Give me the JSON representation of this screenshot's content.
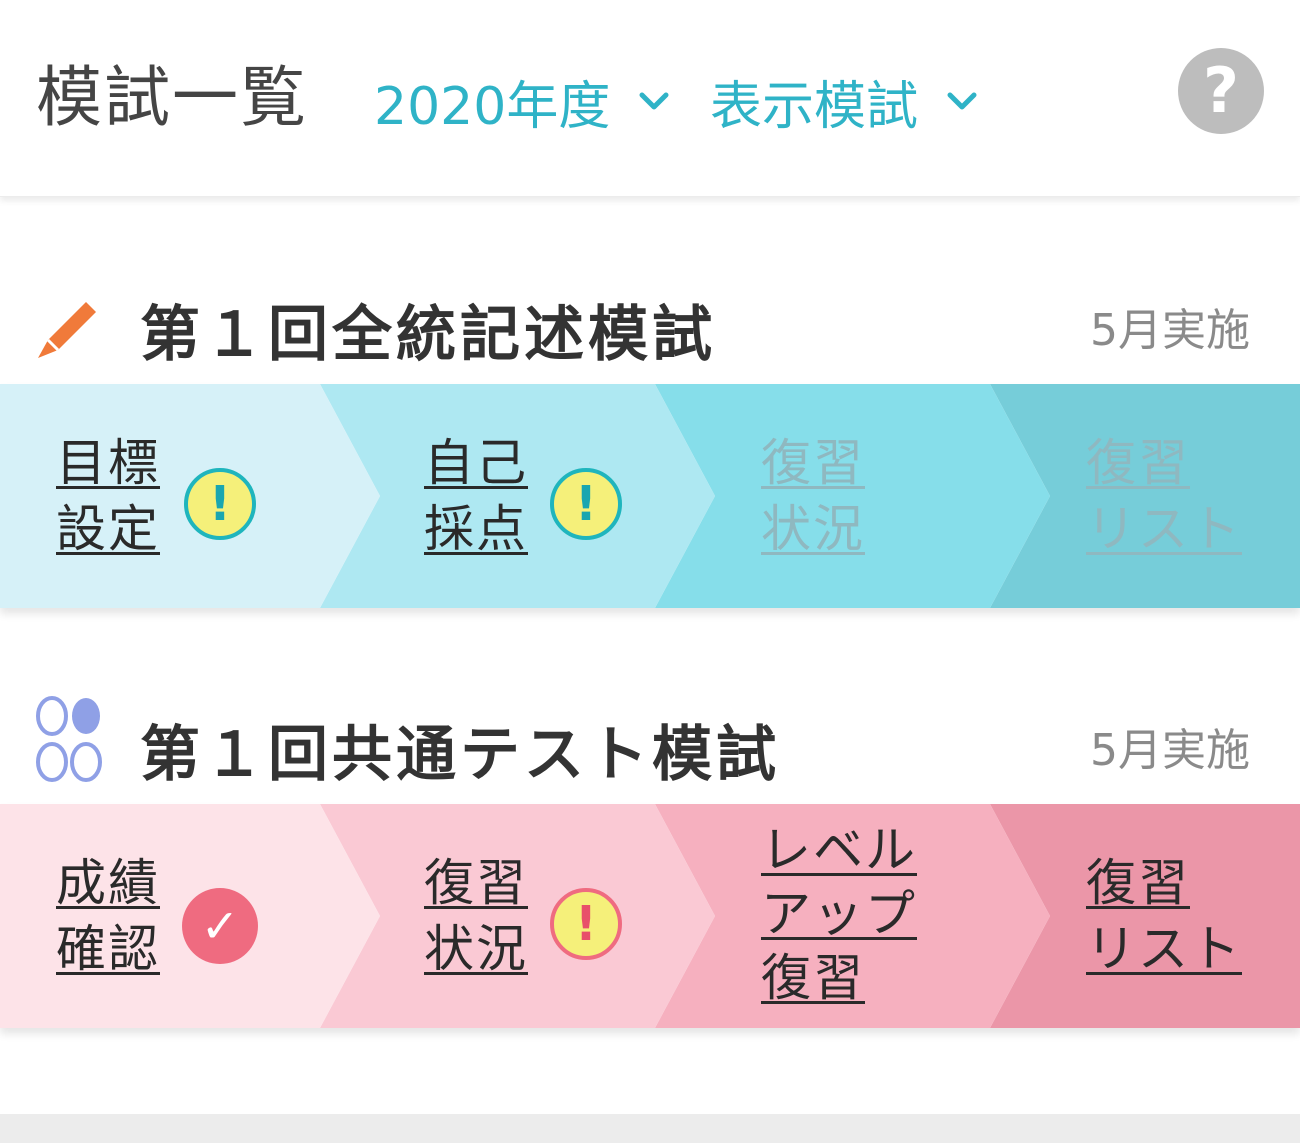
{
  "header": {
    "title": "模試一覧",
    "year_filter": "2020年度",
    "type_filter": "表示模試",
    "help_label": "?"
  },
  "exams": [
    {
      "title": "第１回全統記述模試",
      "date": "5月実施",
      "icon": "pencil-icon",
      "steps": [
        {
          "lines": [
            "目標",
            "設定"
          ],
          "badge": "warning",
          "enabled": true
        },
        {
          "lines": [
            "自己",
            "採点"
          ],
          "badge": "warning",
          "enabled": true
        },
        {
          "lines": [
            "復習",
            "状況"
          ],
          "badge": null,
          "enabled": false
        },
        {
          "lines": [
            "復習",
            "リスト"
          ],
          "badge": null,
          "enabled": false
        }
      ]
    },
    {
      "title": "第１回共通テスト模試",
      "date": "5月実施",
      "icon": "mark-sheet-icon",
      "steps": [
        {
          "lines": [
            "成績",
            "確認"
          ],
          "badge": "check",
          "enabled": true
        },
        {
          "lines": [
            "復習",
            "状況"
          ],
          "badge": "warning",
          "enabled": true
        },
        {
          "lines": [
            "レベル",
            "アップ",
            "復習"
          ],
          "badge": null,
          "enabled": true
        },
        {
          "lines": [
            "復習",
            "リスト"
          ],
          "badge": null,
          "enabled": true
        }
      ]
    }
  ],
  "badge_symbols": {
    "warning": "!",
    "check": "✓"
  },
  "colors": {
    "accent": "#2fb3c7",
    "blue_steps": [
      "#d6f1f8",
      "#aee8f2",
      "#86deea",
      "#76cdd9"
    ],
    "pink_steps": [
      "#fde3e8",
      "#fac9d4",
      "#f6b0bf",
      "#eb96a8"
    ]
  }
}
